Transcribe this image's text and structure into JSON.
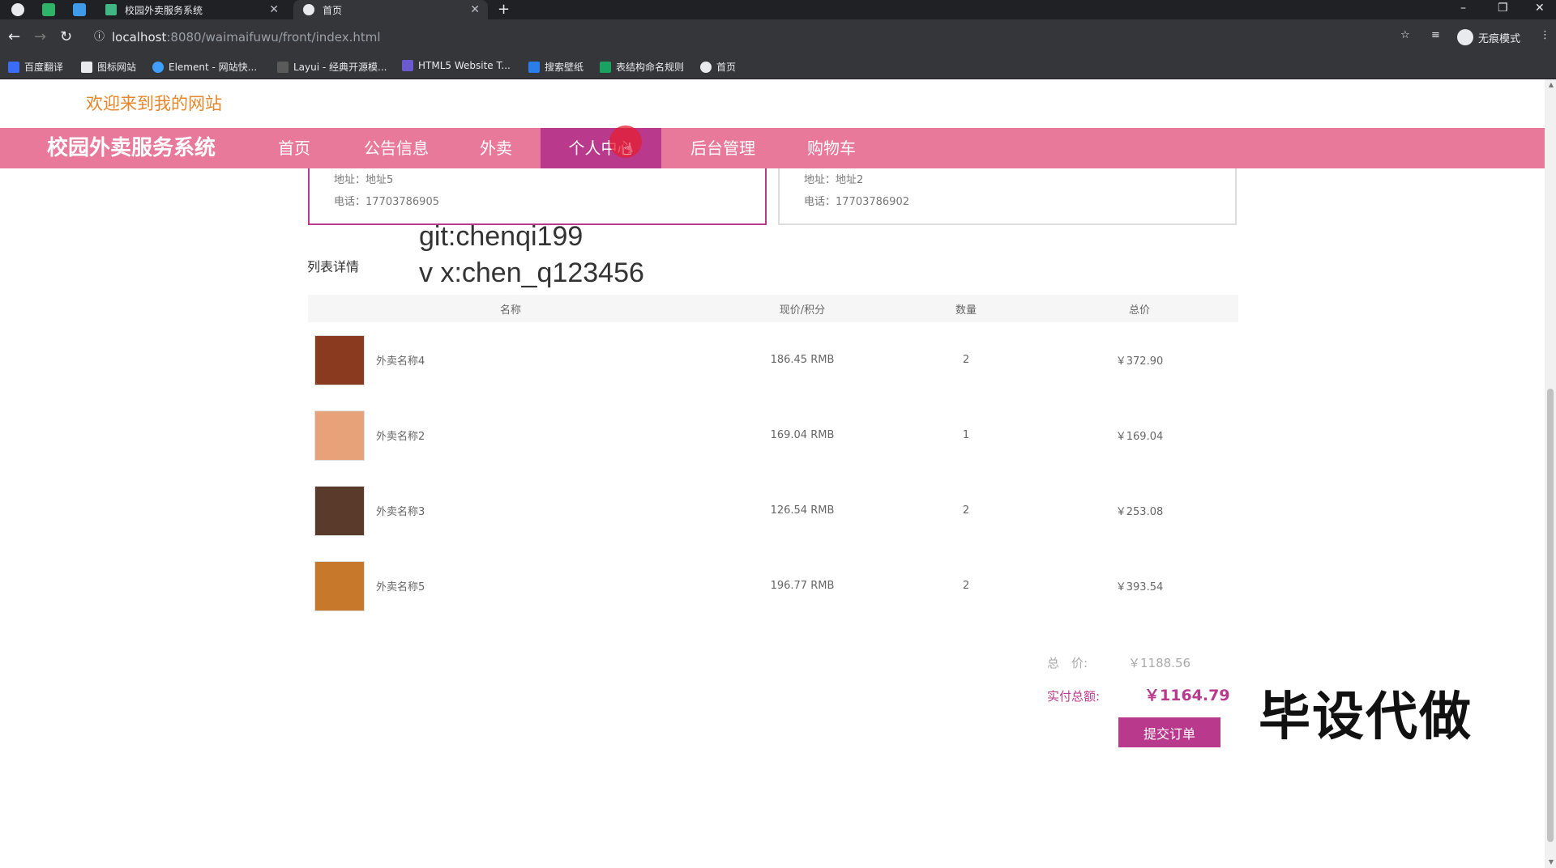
{
  "browser": {
    "tabs": [
      {
        "label": "校园外卖服务系统"
      },
      {
        "label": "首页"
      }
    ],
    "url_host": "localhost",
    "url_path": ":8080/waimaifuwu/front/index.html",
    "incognito_label": "无痕模式",
    "bookmarks": [
      {
        "label": "百度翻译"
      },
      {
        "label": "图标网站"
      },
      {
        "label": "Element - 网站快..."
      },
      {
        "label": "Layui - 经典开源模..."
      },
      {
        "label": "HTML5 Website T..."
      },
      {
        "label": "搜索壁纸"
      },
      {
        "label": "表结构命名规则"
      },
      {
        "label": "首页"
      }
    ]
  },
  "site": {
    "welcome": "欢迎来到我的网站",
    "brand": "校园外卖服务系统",
    "nav": [
      {
        "label": "首页"
      },
      {
        "label": "公告信息"
      },
      {
        "label": "外卖"
      },
      {
        "label": "个人中心"
      },
      {
        "label": "后台管理"
      },
      {
        "label": "购物车"
      }
    ]
  },
  "addresses": [
    {
      "address": "地址：地址5",
      "phone": "电话：17703786905",
      "selected": true
    },
    {
      "address": "地址：地址2",
      "phone": "电话：17703786902",
      "selected": false
    }
  ],
  "watermark": {
    "git": "git:chenqi199",
    "wx": "v x:chen_q123456"
  },
  "list_title": "列表详情",
  "table": {
    "headers": [
      "名称",
      "现价/积分",
      "数量",
      "总价"
    ],
    "rows": [
      {
        "name": "外卖名称4",
        "price": "186.45 RMB",
        "qty": "2",
        "total": "￥372.90",
        "thumb_color": "#8a3a1e"
      },
      {
        "name": "外卖名称2",
        "price": "169.04 RMB",
        "qty": "1",
        "total": "￥169.04",
        "thumb_color": "#e8a27a"
      },
      {
        "name": "外卖名称3",
        "price": "126.54 RMB",
        "qty": "2",
        "total": "￥253.08",
        "thumb_color": "#5a3a2a"
      },
      {
        "name": "外卖名称5",
        "price": "196.77 RMB",
        "qty": "2",
        "total": "￥393.54",
        "thumb_color": "#c7782a"
      }
    ]
  },
  "summary": {
    "total_label": "总　价:",
    "total_value": "￥1188.56",
    "paid_label": "实付总额:",
    "paid_value": "￥1164.79",
    "submit": "提交订单"
  },
  "overlay": "毕设代做",
  "colors": {
    "accent": "#b93a8d",
    "navbar": "#e8799a",
    "welcome": "#e6862a"
  }
}
